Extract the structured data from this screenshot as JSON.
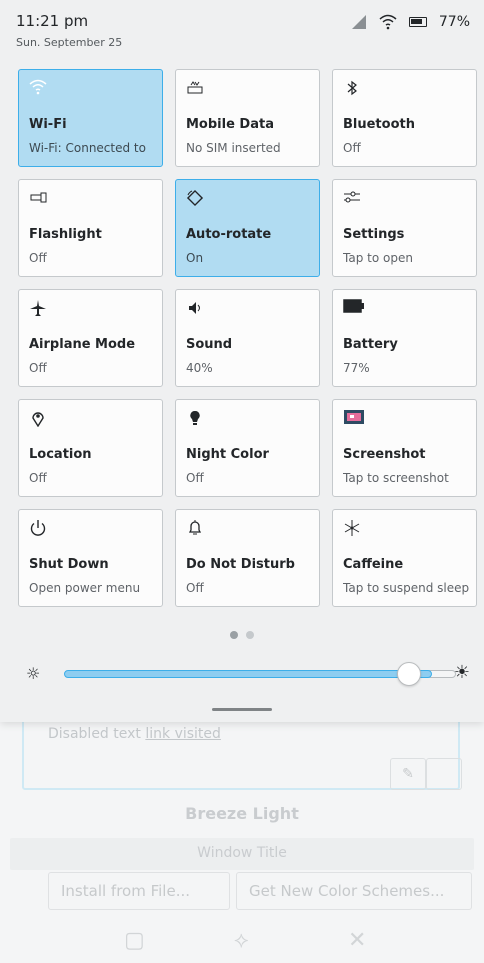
{
  "status": {
    "time": "11:21 pm",
    "date": "Sun. September 25",
    "battery": "77%"
  },
  "tiles": [
    {
      "label": "Wi-Fi",
      "sub": "Wi-Fi: Connected to",
      "icon": "wifi-icon",
      "active": true
    },
    {
      "label": "Mobile Data",
      "sub": "No SIM inserted",
      "icon": "mobile-data-icon",
      "active": false
    },
    {
      "label": "Bluetooth",
      "sub": "Off",
      "icon": "bluetooth-icon",
      "active": false
    },
    {
      "label": "Flashlight",
      "sub": "Off",
      "icon": "flashlight-icon",
      "active": false
    },
    {
      "label": "Auto-rotate",
      "sub": "On",
      "icon": "rotate-icon",
      "active": true
    },
    {
      "label": "Settings",
      "sub": "Tap to open",
      "icon": "settings-icon",
      "active": false
    },
    {
      "label": "Airplane Mode",
      "sub": "Off",
      "icon": "airplane-icon",
      "active": false
    },
    {
      "label": "Sound",
      "sub": "40%",
      "icon": "speaker-icon",
      "active": false
    },
    {
      "label": "Battery",
      "sub": "77%",
      "icon": "battery-icon",
      "active": false
    },
    {
      "label": "Location",
      "sub": "Off",
      "icon": "location-icon",
      "active": false
    },
    {
      "label": "Night Color",
      "sub": "Off",
      "icon": "bulb-icon",
      "active": false
    },
    {
      "label": "Screenshot",
      "sub": "Tap to screenshot",
      "icon": "screenshot-icon",
      "active": false
    },
    {
      "label": "Shut Down",
      "sub": "Open power menu",
      "icon": "power-icon",
      "active": false
    },
    {
      "label": "Do Not Disturb",
      "sub": "Off",
      "icon": "bell-icon",
      "active": false
    },
    {
      "label": "Caffeine",
      "sub": "Tap to suspend sleep",
      "icon": "snowflake-icon",
      "active": false
    }
  ],
  "brightness": {
    "level": 0.92
  },
  "colors": {
    "accent": "#3daee9",
    "active_tile": "#b1dcf2"
  },
  "background_app": {
    "disabled_text": "Disabled text",
    "link_text": "link visited",
    "title": "Breeze Light",
    "window_title": "Window Title",
    "install_button": "Install from File...",
    "get_schemes_button": "Get New Color Schemes..."
  }
}
